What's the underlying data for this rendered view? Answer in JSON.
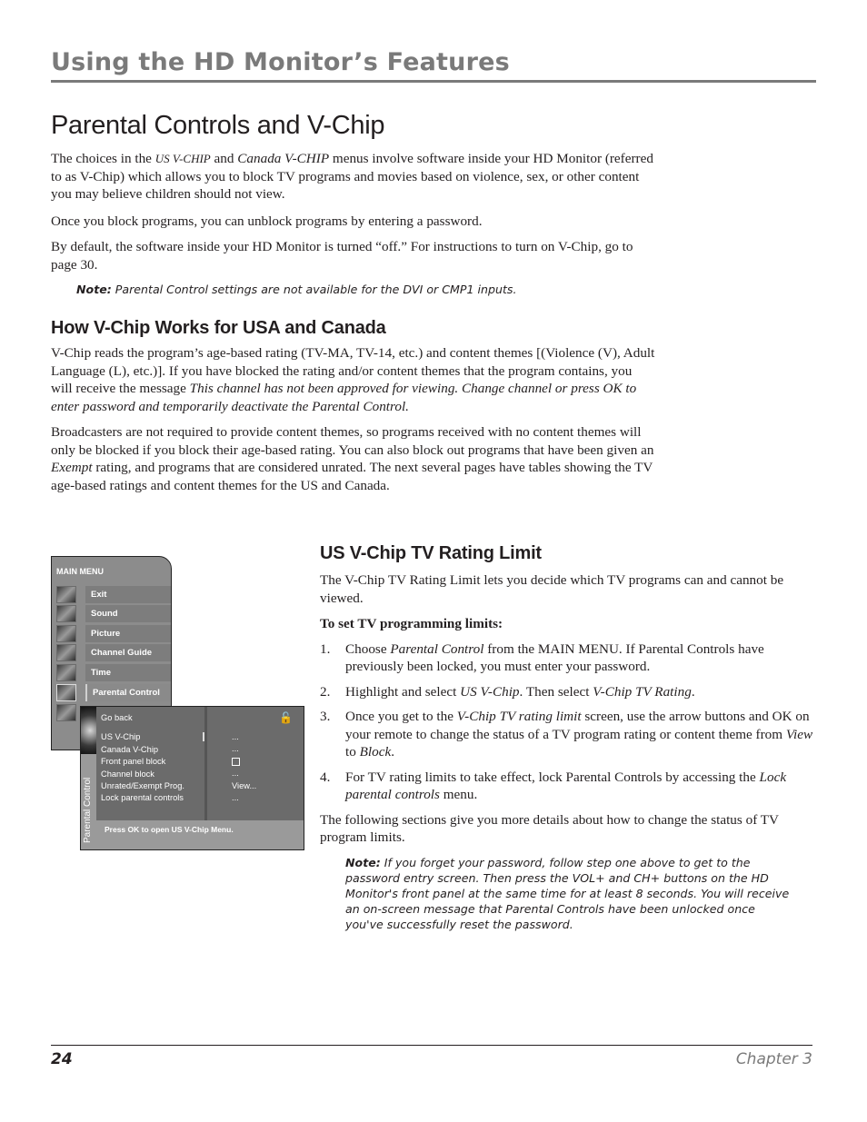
{
  "header": {
    "section_title": "Using the HD Monitor’s Features"
  },
  "page_title": "Parental Controls and V-Chip",
  "intro": {
    "p1": {
      "before": "The choices in the ",
      "em1": "US V-CHIP",
      "mid": " and ",
      "em2": "Canada V-CHIP",
      "after": " menus involve software inside your HD Monitor (referred to as V-Chip) which allows you to block TV programs and movies based on violence, sex, or other content you may believe children should not view."
    },
    "p2": "Once you block programs, you can unblock programs by entering a password.",
    "p3": "By default, the software inside your HD Monitor is turned “off.” For instructions to turn on V-Chip, go to page 30.",
    "note_label": "Note:",
    "note_text": " Parental Control settings are not available for the DVI or CMP1 inputs."
  },
  "how_section": {
    "heading": "How V-Chip Works for USA and Canada",
    "p1_before": "V-Chip reads the program’s age-based rating (TV-MA, TV-14, etc.) and content themes [(Violence (V), Adult Language (L), etc.)]. If you have blocked the rating and/or content themes that the program contains, you will receive the message ",
    "p1_em": "This channel has not been approved for viewing. Change channel or press OK to enter password and temporarily deactivate the Parental Control.",
    "p2_before": "Broadcasters are not required to provide content themes, so programs received with no content themes will only be blocked if you block their age-based rating. You can also block out programs that have been given an ",
    "p2_em": "Exempt",
    "p2_after": " rating, and programs that are considered unrated. The next several pages have tables showing the TV age-based ratings and content themes for the US and Canada."
  },
  "menu_screenshot": {
    "main_menu_title": "MAIN MENU",
    "main_menu_items": [
      {
        "label": "Exit",
        "icon": "exit-thumbnail-icon"
      },
      {
        "label": "Sound",
        "icon": "sound-thumbnail-icon"
      },
      {
        "label": "Picture",
        "icon": "picture-thumbnail-icon"
      },
      {
        "label": "Channel Guide",
        "icon": "channel-guide-thumbnail-icon"
      },
      {
        "label": "Time",
        "icon": "time-thumbnail-icon"
      },
      {
        "label": "Parental Control",
        "icon": "parental-control-thumbnail-icon",
        "active": true
      }
    ],
    "panel_side_label": "Parental Control",
    "panel_items": [
      "Go back",
      "US V-Chip",
      "Canada V-Chip",
      "Front panel block",
      "Channel block",
      "Unrated/Exempt Prog.",
      "Lock parental controls"
    ],
    "panel_values": [
      "...",
      "...",
      "checkbox",
      "...",
      "View...",
      "..."
    ],
    "lock_icon": "unlocked-padlock-icon",
    "status_text": "Press OK to open US V-Chip Menu."
  },
  "rating_section": {
    "heading": "US V-Chip TV Rating Limit",
    "intro": "The V-Chip TV Rating Limit lets you decide which TV programs can and cannot be viewed.",
    "subheading": "To set TV programming limits:",
    "steps": [
      {
        "num": "1.",
        "a": "Choose ",
        "em1": "Parental Control",
        "b": " from the MAIN MENU. If Parental Controls have previously been locked, you must enter your password.",
        "em2": "",
        "c": ""
      },
      {
        "num": "2.",
        "a": "Highlight and select ",
        "em1": "US V-Chip",
        "b": ". Then select ",
        "em2": "V-Chip TV Rating",
        "c": "."
      },
      {
        "num": "3.",
        "a": "Once you get to the ",
        "em1": "V-Chip TV rating limit",
        "b": " screen, use the arrow buttons and OK on your remote to change the status of a TV program rating or content theme from ",
        "em2": "View",
        "c": " to ",
        "em3": "Block",
        "d": "."
      },
      {
        "num": "4.",
        "a": "For TV rating limits to take effect, lock Parental Controls by accessing the ",
        "em1": "Lock parental controls",
        "b": " menu.",
        "em2": "",
        "c": ""
      }
    ],
    "following": "The following sections give you more details about how to change the status of TV program limits.",
    "note_label": "Note:",
    "note_text": "  If you forget your password, follow step one above to get to the password entry screen. Then press the VOL+ and CH+ buttons on the HD Monitor's front panel at the same time for at least 8 seconds. You will receive an on-screen message that Parental Controls have been unlocked once you've successfully reset the password."
  },
  "footer": {
    "page_number": "24",
    "chapter": "Chapter 3"
  }
}
